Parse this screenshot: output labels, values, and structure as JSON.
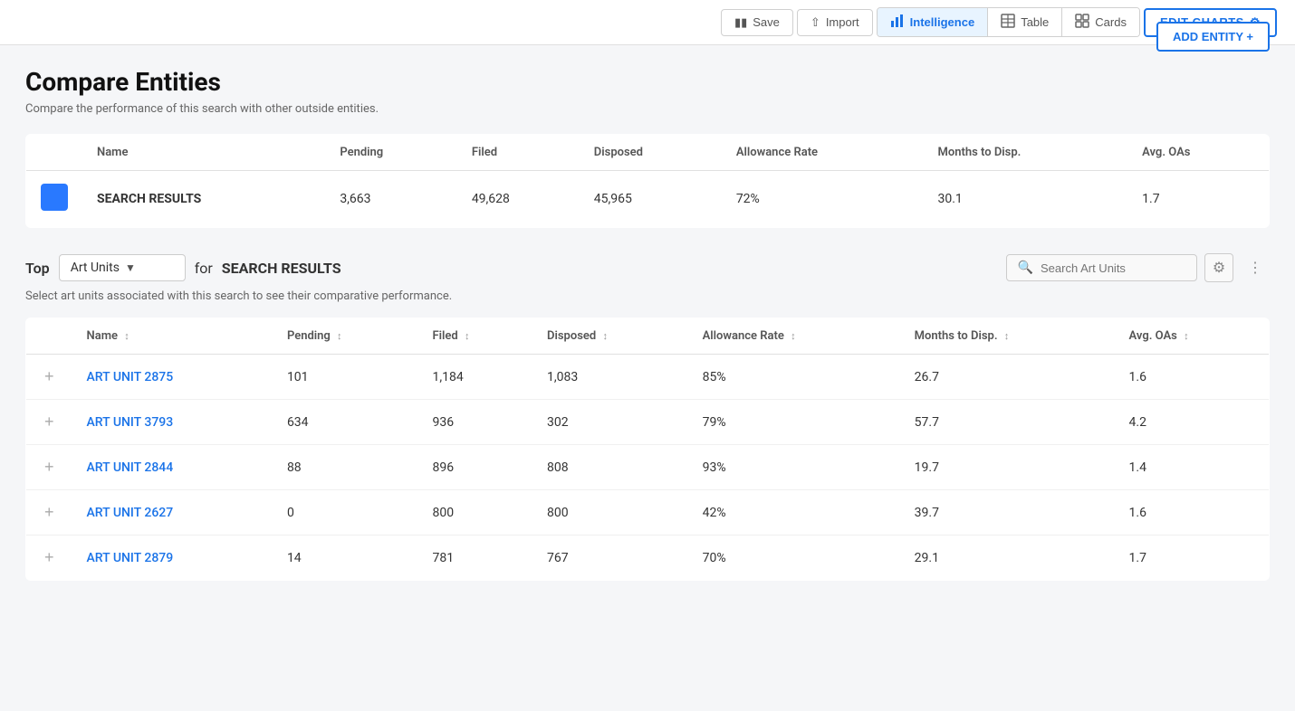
{
  "toolbar": {
    "save_label": "Save",
    "import_label": "Import",
    "intelligence_label": "Intelligence",
    "table_label": "Table",
    "cards_label": "Cards",
    "edit_charts_label": "EDIT CHARTS",
    "active_tab": "intelligence"
  },
  "page": {
    "title": "Compare Entities",
    "subtitle": "Compare the performance of this search with other outside entities.",
    "add_entity_label": "ADD ENTITY +"
  },
  "entities_table": {
    "columns": [
      "Name",
      "Pending",
      "Filed",
      "Disposed",
      "Allowance Rate",
      "Months to Disp.",
      "Avg. OAs"
    ],
    "rows": [
      {
        "color": "#2979FF",
        "name": "SEARCH RESULTS",
        "pending": "3,663",
        "filed": "49,628",
        "disposed": "45,965",
        "allowance_rate": "72%",
        "months_to_disp": "30.1",
        "avg_oas": "1.7"
      }
    ]
  },
  "top_section": {
    "top_label": "Top",
    "dropdown_value": "Art Units",
    "for_label": "for",
    "results_label": "SEARCH RESULTS",
    "search_placeholder": "Search Art Units",
    "description": "Select art units associated with this search to see their comparative performance."
  },
  "art_units_table": {
    "columns": [
      {
        "label": "Name",
        "sortable": true
      },
      {
        "label": "Pending",
        "sortable": true
      },
      {
        "label": "Filed",
        "sortable": true
      },
      {
        "label": "Disposed",
        "sortable": true
      },
      {
        "label": "Allowance Rate",
        "sortable": true
      },
      {
        "label": "Months to Disp.",
        "sortable": true
      },
      {
        "label": "Avg. OAs",
        "sortable": true
      }
    ],
    "rows": [
      {
        "name": "ART UNIT 2875",
        "pending": "101",
        "filed": "1,184",
        "disposed": "1,083",
        "allowance_rate": "85%",
        "months_to_disp": "26.7",
        "avg_oas": "1.6"
      },
      {
        "name": "ART UNIT 3793",
        "pending": "634",
        "filed": "936",
        "disposed": "302",
        "allowance_rate": "79%",
        "months_to_disp": "57.7",
        "avg_oas": "4.2"
      },
      {
        "name": "ART UNIT 2844",
        "pending": "88",
        "filed": "896",
        "disposed": "808",
        "allowance_rate": "93%",
        "months_to_disp": "19.7",
        "avg_oas": "1.4"
      },
      {
        "name": "ART UNIT 2627",
        "pending": "0",
        "filed": "800",
        "disposed": "800",
        "allowance_rate": "42%",
        "months_to_disp": "39.7",
        "avg_oas": "1.6"
      },
      {
        "name": "ART UNIT 2879",
        "pending": "14",
        "filed": "781",
        "disposed": "767",
        "allowance_rate": "70%",
        "months_to_disp": "29.1",
        "avg_oas": "1.7"
      }
    ]
  }
}
